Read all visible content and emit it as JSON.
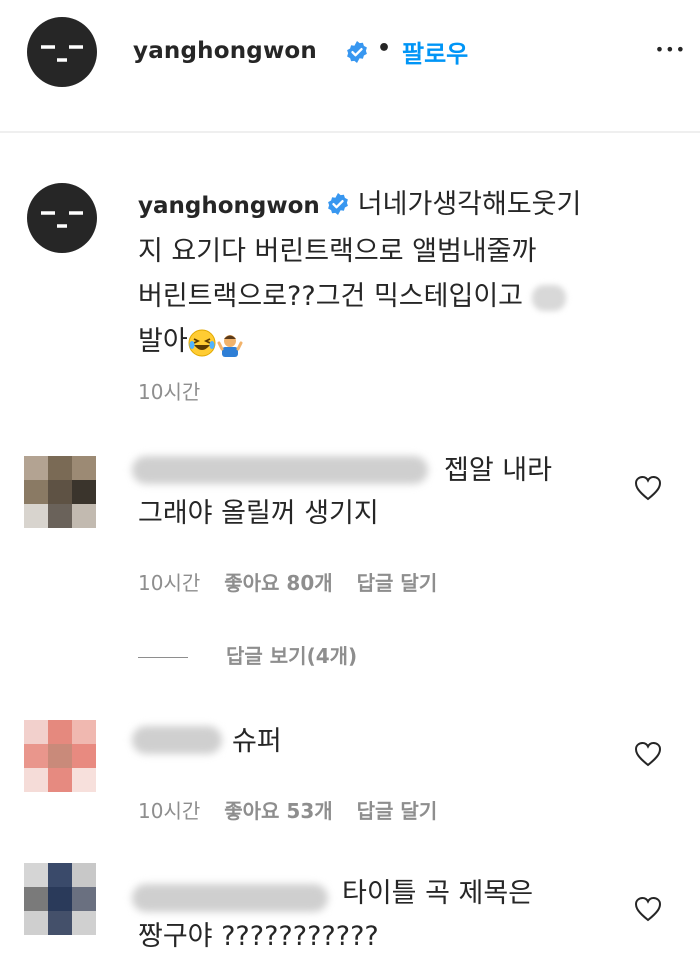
{
  "header": {
    "username": "yanghongwon",
    "dot": "•",
    "follow_label": "팔로우",
    "more_label": "•••"
  },
  "caption": {
    "username": "yanghongwon",
    "text_line1": "너네가생각해도웃기",
    "text_line2": "지 요기다 버린트랙으로 앨범내줄까",
    "text_line3": "버린트랙으로??그건 믹스테입이고",
    "text_line4": "발아",
    "time": "10시간"
  },
  "comments": [
    {
      "text_line1": "젭알 내라",
      "text_line2": "그래야 올릴꺼 생기지",
      "time": "10시간",
      "likes": "좋아요 80개",
      "reply_label": "답글 달기",
      "view_replies": "답글 보기(4개)"
    },
    {
      "text_line1": "슈퍼",
      "time": "10시간",
      "likes": "좋아요 53개",
      "reply_label": "답글 달기"
    },
    {
      "text_line1": "타이틀 곡 제목은",
      "text_line2": "짱구야 ???????????"
    }
  ],
  "colors": {
    "accent": "#0095f6",
    "verified": "#3897f0",
    "muted": "#8e8e8e",
    "text": "#262626"
  },
  "icons": [
    "verified-badge-icon",
    "more-options-icon",
    "heart-icon",
    "laughing-emoji-icon",
    "shrug-emoji-icon"
  ]
}
